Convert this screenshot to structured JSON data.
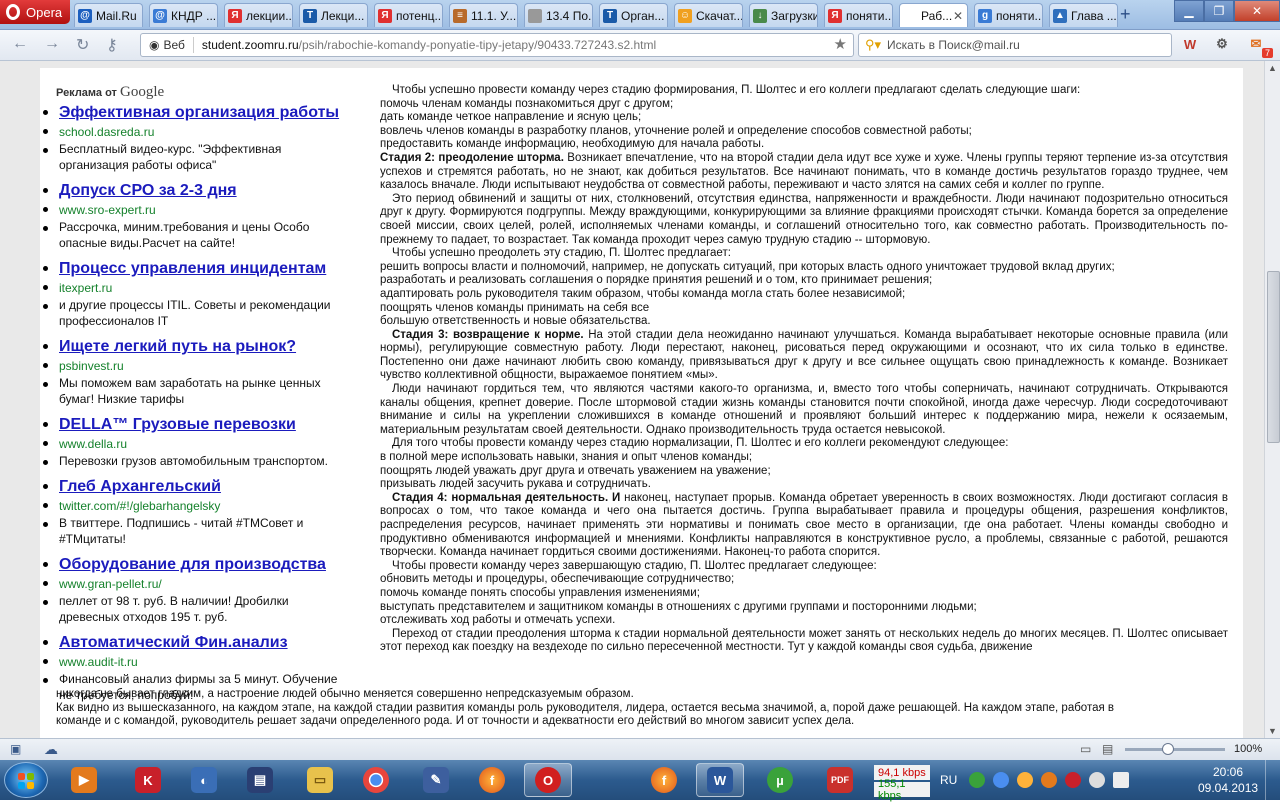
{
  "browser": {
    "opera_label": "Opera",
    "tabs": [
      {
        "label": "Mail.Ru",
        "fav_color": "#1c5fbf",
        "fav_text": "@"
      },
      {
        "label": "КНДР ...",
        "fav_color": "#3a7bd5",
        "fav_text": "@"
      },
      {
        "label": "лекции...",
        "fav_color": "#e03030",
        "fav_text": "Я"
      },
      {
        "label": "Лекци...",
        "fav_color": "#1a5aa8",
        "fav_text": "T"
      },
      {
        "label": "потенц...",
        "fav_color": "#e03030",
        "fav_text": "Я"
      },
      {
        "label": "11.1. У...",
        "fav_color": "#b86a2a",
        "fav_text": "≡"
      },
      {
        "label": "13.4 По...",
        "fav_color": "#999999",
        "fav_text": ""
      },
      {
        "label": "Орган...",
        "fav_color": "#1a5aa8",
        "fav_text": "T"
      },
      {
        "label": "Скачат...",
        "fav_color": "#f0a020",
        "fav_text": "☺"
      },
      {
        "label": "Загрузки",
        "fav_color": "#4a8a4a",
        "fav_text": "↓"
      },
      {
        "label": "поняти...",
        "fav_color": "#e03030",
        "fav_text": "Я"
      },
      {
        "label": "Раб...",
        "fav_color": "#ffffff",
        "fav_text": "",
        "active": true
      },
      {
        "label": "поняти...",
        "fav_color": "#3a7bd5",
        "fav_text": "g"
      },
      {
        "label": "Глава ...",
        "fav_color": "#2f6fbd",
        "fav_text": "▲"
      }
    ],
    "new_tab": "+",
    "back_icon": "←",
    "forward_icon": "→",
    "reload_icon": "↻",
    "key_icon": "⚷",
    "web_label": "Веб",
    "url_host": "student.zoomru.ru",
    "url_path": "/psih/rabochie-komandy-ponyatie-tipy-jetapy/90433.727243.s2.html",
    "search_placeholder": "Искать в Поиск@mail.ru",
    "mail_badge": "7",
    "zoom_level": "100%"
  },
  "ads": {
    "header_prefix": "Реклама от",
    "header_brand": "Google",
    "items": [
      {
        "title": "Эффективная организация работы",
        "url": "school.dasreda.ru",
        "desc": "Бесплатный видео-курс. \"Эффективная организация работы офиса\""
      },
      {
        "title": "Допуск СРО за 2-3 дня",
        "url": "www.sro-expert.ru",
        "desc": "Рассрочка, миним.требования и цены Особо опасные виды.Расчет на сайте!"
      },
      {
        "title": "Процесс управления инцидентам",
        "url": "itexpert.ru",
        "desc": "и другие процессы ITIL. Советы и рекомендации профессионалов IT"
      },
      {
        "title": "Ищете легкий путь на рынок?",
        "url": "psbinvest.ru",
        "desc": "Мы поможем вам заработать на рынке ценных бумаг! Низкие тарифы"
      },
      {
        "title": "DELLA™ Грузовые перевозки",
        "url": "www.della.ru",
        "desc": "Перевозки грузов автомобильным транспортом."
      },
      {
        "title": "Глеб Архангельский",
        "url": "twitter.com/#!/glebarhangelsky",
        "desc": "В твиттере. Подпишись - читай #ТМСовет и #ТМцитаты!"
      },
      {
        "title": "Оборудование для производства",
        "url": "www.gran-pellet.ru/",
        "desc": "пеллет от 98 т. руб. В наличии! Дробилки древесных отходов 195 т. руб."
      },
      {
        "title": "Автоматический Фин.анализ",
        "url": "www.audit-it.ru",
        "desc": "Финансовый анализ фирмы за 5 минут. Обучение не требуется, попробуй!"
      }
    ]
  },
  "article": {
    "p1": "Чтобы успешно провести команду через стадию формирования, П. Шолтес и его коллеги предлагают сделать следующие шаги:",
    "l1": "помочь членам команды познакомиться друг с другом;",
    "l2": "дать команде четкое направление и ясную цель;",
    "l3": "вовлечь членов команды в разработку планов, уточнение ролей и определение способов совместной работы;",
    "l4": "предоставить команде информацию, необходимую для начала работы.",
    "s2_head": "Стадия 2: преодоление шторма.",
    "s2_text": " Возникает впечатление, что на второй стадии дела идут все хуже и хуже. Члены группы теряют терпение из-за отсутствия успехов и стремятся работать, но не знают, как добиться результатов. Все начинают понимать, что в команде достичь результатов гораздо труднее, чем казалось вначале. Люди испытывают неудобства от совместной работы, переживают и часто злятся на самих себя и коллег по группе.",
    "p2": "Это период обвинений и защиты от них, столкновений, отсутствия единства, напряженности и враждебности. Люди начинают подозрительно относиться друг к другу. Формируются подгруппы. Между враждующими, конкурирующими за влияние фракциями происходят стычки. Команда борется за определение своей миссии, своих целей, ролей, исполняемых членами команды, и соглашений относительно того, как совместно работать. Производительность по-прежнему то падает, то возрастает. Так команда проходит через самую трудную стадию -- штормовую.",
    "p3": "Чтобы успешно преодолеть эту стадию, П. Шолтес предлагает:",
    "l5": "решить вопросы власти и полномочий, например, не допускать ситуаций, при которых власть одного уничтожает трудовой вклад других;",
    "l6": "разработать и реализовать соглашения о порядке принятия решений и о том, кто принимает решения;",
    "l7": "адаптировать роль руководителя таким образом, чтобы команда могла стать более независимой;",
    "l8": "поощрять членов команды принимать на себя все",
    "l9": "большую ответственность и новые обязательства.",
    "s3_head": "Стадия 3: возвращение к норме.",
    "s3_text": " На этой стадии дела неожиданно начинают улучшаться. Команда вырабатывает некоторые основные правила (или нормы), регулирующие совместную работу. Люди перестают, наконец, рисоваться перед окружающими и осознают, что их сила только в единстве. Постепенно они даже начинают любить свою команду, привязываться друг к другу и все сильнее ощущать свою принадлежность к команде. Возникает чувство коллективной общности, выражаемое понятием «мы».",
    "p4": "Люди начинают гордиться тем, что являются частями какого-то организма, и, вместо того чтобы соперничать, начинают сотрудничать. Открываются каналы общения, крепнет доверие. После штормовой стадии жизнь команды становится почти спокойной, иногда даже чересчур. Люди сосредоточивают внимание и силы на укреплении сложившихся в команде отношений и проявляют больший интерес к поддержанию мира, нежели к осязаемым, материальным результатам своей деятельности. Однако производительность труда остается невысокой.",
    "p5": "Для того чтобы провести команду через стадию нормализации, П. Шолтес и его коллеги рекомендуют следующее:",
    "l10": "в полной мере использовать навыки, знания и опыт членов команды;",
    "l11": "поощрять людей уважать друг друга и отвечать уважением на уважение;",
    "l12": "призывать людей засучить рукава и сотрудничать.",
    "s4_head": "Стадия 4: нормальная деятельность. И",
    "s4_text": " наконец, наступает прорыв. Команда обретает уверенность в своих возможностях. Люди достигают согласия в вопросах о том, что такое команда и чего она пытается достичь. Группа вырабатывает правила и процедуры общения, разрешения конфликтов, распределения ресурсов, начинает применять эти нормативы и понимать свое место в организации, где она работает. Члены команды свободно и продуктивно обмениваются информацией и мнениями. Конфликты направляются в конструктивное русло, а проблемы, связанные с работой, решаются творчески. Команда начинает гордиться своими достижениями. Наконец-то работа спорится.",
    "p6": "Чтобы провести команду через завершающую стадию, П. Шолтес предлагает следующее:",
    "l13": "обновить методы и процедуры, обеспечивающие сотрудничество;",
    "l14": "помочь команде понять способы управления изменениями;",
    "l15": "выступать представителем и защитником команды в отношениях с другими группами и посторонними людьми;",
    "l16": "отслеживать ход работы и отмечать успехи.",
    "p7a": "Переход от стадии преодоления шторма к стадии нормальной деятельности может занять от нескольких недель до многих месяцев. П. Шолтес описывает этот переход как поездку на вездеходе по сильно пересеченной местности. Тут у каждой команды своя судьба, движение",
    "p7b": "никогда не бывает гладким, а настроение людей обычно меняется совершенно непредсказуемым образом.",
    "p8": "Как видно из вышесказанного, на каждом этапе, на каждой стадии развития команды роль руководителя, лидера, остается весьма значимой, а, порой даже решающей. На каждом этапе, работая в",
    "p9": "команде и с командой, руководитель решает задачи определенного рода. И от точности и адекватности его действий во многом зависит успех дела."
  },
  "taskbar": {
    "net_down": "94,1 kbps",
    "net_up": "155,1 kbps",
    "lang": "RU",
    "time": "20:06",
    "date": "09.04.2013"
  }
}
